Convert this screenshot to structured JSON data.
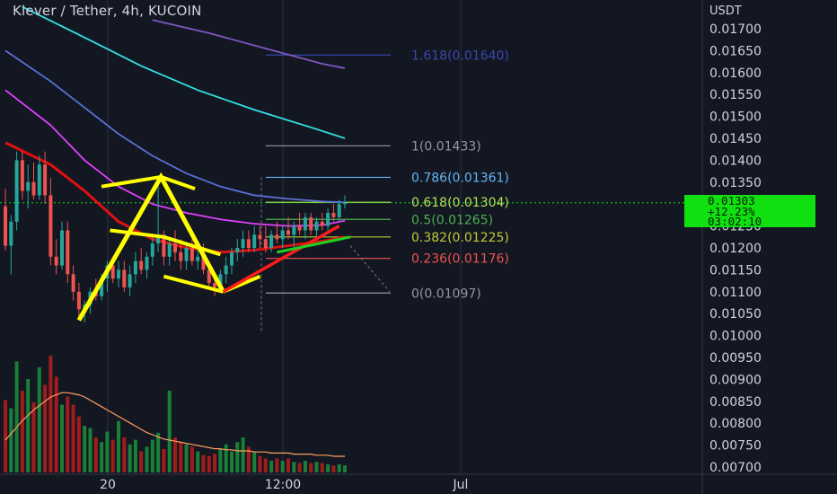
{
  "header": {
    "title": "Klever / Tether, 4h, KUCOIN"
  },
  "colors": {
    "background": "#131722",
    "axis_text": "#d1d4dc",
    "grid": "#2a2e39",
    "up": "#26a69a",
    "down": "#ef5350",
    "drawing": "#ffff00",
    "ma_red": "#e01010",
    "ma_magenta": "#e040fb",
    "ma_blue": "#5b6fd6",
    "ma_cyan": "#33e0e6",
    "ma_purple": "#7e57c2",
    "volume_ma": "#ff9e60",
    "price_tag": "#10e010"
  },
  "chart_data": {
    "type": "candlestick",
    "symbol": "Klever / Tether",
    "timeframe": "4h",
    "exchange": "KUCOIN",
    "y_axis_label": "USDT",
    "ylim": [
      0.0069,
      0.0175
    ],
    "y_ticks": [
      "0.01700",
      "0.01650",
      "0.01600",
      "0.01550",
      "0.01500",
      "0.01450",
      "0.01400",
      "0.01350",
      "0.01300",
      "0.01250",
      "0.01200",
      "0.01150",
      "0.01100",
      "0.01050",
      "0.01000",
      "0.00950",
      "0.00900",
      "0.00850",
      "0.00800",
      "0.00750",
      "0.00700"
    ],
    "x_ticks": [
      "20",
      "12:00",
      "Jul"
    ],
    "current_price": {
      "value": "0.01303",
      "change": "+12.23%",
      "countdown": "03:02:10"
    },
    "fib_levels": [
      {
        "level": "1.618",
        "value": 0.0164,
        "label": "1.618(0.01640)",
        "color": "#3949ab"
      },
      {
        "level": "1",
        "value": 0.01433,
        "label": "1(0.01433)",
        "color": "#9598a1"
      },
      {
        "level": "0.786",
        "value": 0.01361,
        "label": "0.786(0.01361)",
        "color": "#64b5f6"
      },
      {
        "level": "0.618",
        "value": 0.01304,
        "label": "0.618(0.01304)",
        "color": "#b6e35a"
      },
      {
        "level": "0.5",
        "value": 0.01265,
        "label": "0.5(0.01265)",
        "color": "#4caf50"
      },
      {
        "level": "0.382",
        "value": 0.01225,
        "label": "0.382(0.01225)",
        "color": "#c0ca33"
      },
      {
        "level": "0.236",
        "value": 0.01176,
        "label": "0.236(0.01176)",
        "color": "#ef5350"
      },
      {
        "level": "0",
        "value": 0.01097,
        "label": "0(0.01097)",
        "color": "#9598a1"
      }
    ],
    "candles": [
      {
        "o": 0.01295,
        "h": 0.01335,
        "l": 0.01195,
        "c": 0.01205
      },
      {
        "o": 0.01205,
        "h": 0.01275,
        "l": 0.0114,
        "c": 0.0126
      },
      {
        "o": 0.0126,
        "h": 0.0142,
        "l": 0.0124,
        "c": 0.014
      },
      {
        "o": 0.014,
        "h": 0.0142,
        "l": 0.0131,
        "c": 0.0133
      },
      {
        "o": 0.0133,
        "h": 0.0139,
        "l": 0.0129,
        "c": 0.0135
      },
      {
        "o": 0.0135,
        "h": 0.01395,
        "l": 0.0131,
        "c": 0.0132
      },
      {
        "o": 0.0132,
        "h": 0.0141,
        "l": 0.0131,
        "c": 0.0139
      },
      {
        "o": 0.0139,
        "h": 0.0142,
        "l": 0.013,
        "c": 0.0132
      },
      {
        "o": 0.0132,
        "h": 0.0136,
        "l": 0.0116,
        "c": 0.0118
      },
      {
        "o": 0.0118,
        "h": 0.0122,
        "l": 0.0114,
        "c": 0.0116
      },
      {
        "o": 0.0116,
        "h": 0.0126,
        "l": 0.0115,
        "c": 0.0124
      },
      {
        "o": 0.0124,
        "h": 0.0126,
        "l": 0.0112,
        "c": 0.0114
      },
      {
        "o": 0.0114,
        "h": 0.0116,
        "l": 0.0108,
        "c": 0.011
      },
      {
        "o": 0.011,
        "h": 0.0112,
        "l": 0.0104,
        "c": 0.0106
      },
      {
        "o": 0.0106,
        "h": 0.0108,
        "l": 0.0103,
        "c": 0.0107
      },
      {
        "o": 0.0107,
        "h": 0.0111,
        "l": 0.0105,
        "c": 0.011
      },
      {
        "o": 0.011,
        "h": 0.0113,
        "l": 0.0108,
        "c": 0.0109
      },
      {
        "o": 0.0109,
        "h": 0.0114,
        "l": 0.0108,
        "c": 0.0113
      },
      {
        "o": 0.0113,
        "h": 0.0117,
        "l": 0.011,
        "c": 0.0116
      },
      {
        "o": 0.0116,
        "h": 0.0118,
        "l": 0.0112,
        "c": 0.0113
      },
      {
        "o": 0.0113,
        "h": 0.0117,
        "l": 0.0111,
        "c": 0.0115
      },
      {
        "o": 0.0115,
        "h": 0.0117,
        "l": 0.011,
        "c": 0.0111
      },
      {
        "o": 0.0111,
        "h": 0.0116,
        "l": 0.0109,
        "c": 0.0114
      },
      {
        "o": 0.0114,
        "h": 0.0119,
        "l": 0.0112,
        "c": 0.0117
      },
      {
        "o": 0.0117,
        "h": 0.012,
        "l": 0.0114,
        "c": 0.0115
      },
      {
        "o": 0.0115,
        "h": 0.0119,
        "l": 0.0113,
        "c": 0.0118
      },
      {
        "o": 0.0118,
        "h": 0.0123,
        "l": 0.0116,
        "c": 0.0121
      },
      {
        "o": 0.0121,
        "h": 0.0136,
        "l": 0.0119,
        "c": 0.0123
      },
      {
        "o": 0.0123,
        "h": 0.0124,
        "l": 0.0116,
        "c": 0.0118
      },
      {
        "o": 0.0118,
        "h": 0.0122,
        "l": 0.0116,
        "c": 0.0121
      },
      {
        "o": 0.0121,
        "h": 0.0124,
        "l": 0.0117,
        "c": 0.0119
      },
      {
        "o": 0.0119,
        "h": 0.0122,
        "l": 0.0115,
        "c": 0.0117
      },
      {
        "o": 0.0117,
        "h": 0.0121,
        "l": 0.0115,
        "c": 0.012
      },
      {
        "o": 0.012,
        "h": 0.0122,
        "l": 0.0116,
        "c": 0.0117
      },
      {
        "o": 0.0117,
        "h": 0.012,
        "l": 0.0115,
        "c": 0.0118
      },
      {
        "o": 0.0118,
        "h": 0.0121,
        "l": 0.0114,
        "c": 0.0115
      },
      {
        "o": 0.0115,
        "h": 0.0116,
        "l": 0.0111,
        "c": 0.0112
      },
      {
        "o": 0.0112,
        "h": 0.0114,
        "l": 0.0109,
        "c": 0.0111
      },
      {
        "o": 0.0111,
        "h": 0.0115,
        "l": 0.011,
        "c": 0.0114
      },
      {
        "o": 0.0114,
        "h": 0.0118,
        "l": 0.0112,
        "c": 0.0116
      },
      {
        "o": 0.0116,
        "h": 0.012,
        "l": 0.0114,
        "c": 0.0119
      },
      {
        "o": 0.0119,
        "h": 0.0122,
        "l": 0.0117,
        "c": 0.012
      },
      {
        "o": 0.012,
        "h": 0.0124,
        "l": 0.0118,
        "c": 0.0122
      },
      {
        "o": 0.0122,
        "h": 0.0124,
        "l": 0.0119,
        "c": 0.012
      },
      {
        "o": 0.012,
        "h": 0.0125,
        "l": 0.0119,
        "c": 0.0123
      },
      {
        "o": 0.0123,
        "h": 0.0125,
        "l": 0.012,
        "c": 0.0122
      },
      {
        "o": 0.0122,
        "h": 0.0125,
        "l": 0.0119,
        "c": 0.012
      },
      {
        "o": 0.012,
        "h": 0.0124,
        "l": 0.0119,
        "c": 0.0123
      },
      {
        "o": 0.0123,
        "h": 0.0126,
        "l": 0.0121,
        "c": 0.0122
      },
      {
        "o": 0.0122,
        "h": 0.0125,
        "l": 0.012,
        "c": 0.0124
      },
      {
        "o": 0.0124,
        "h": 0.0127,
        "l": 0.0122,
        "c": 0.0123
      },
      {
        "o": 0.0123,
        "h": 0.0126,
        "l": 0.012,
        "c": 0.0125
      },
      {
        "o": 0.0125,
        "h": 0.0128,
        "l": 0.0123,
        "c": 0.0124
      },
      {
        "o": 0.0124,
        "h": 0.0128,
        "l": 0.0122,
        "c": 0.0127
      },
      {
        "o": 0.0127,
        "h": 0.0128,
        "l": 0.0123,
        "c": 0.0124
      },
      {
        "o": 0.0124,
        "h": 0.0127,
        "l": 0.0122,
        "c": 0.0126
      },
      {
        "o": 0.0126,
        "h": 0.0128,
        "l": 0.0124,
        "c": 0.0125
      },
      {
        "o": 0.0125,
        "h": 0.0129,
        "l": 0.0124,
        "c": 0.0128
      },
      {
        "o": 0.0128,
        "h": 0.013,
        "l": 0.0126,
        "c": 0.0127
      },
      {
        "o": 0.0127,
        "h": 0.0131,
        "l": 0.0126,
        "c": 0.013
      },
      {
        "o": 0.013,
        "h": 0.0132,
        "l": 0.0129,
        "c": 0.01303
      }
    ],
    "volume": [
      62,
      55,
      95,
      70,
      80,
      60,
      90,
      75,
      100,
      82,
      58,
      65,
      58,
      48,
      40,
      38,
      30,
      26,
      35,
      28,
      44,
      30,
      24,
      28,
      18,
      22,
      28,
      34,
      20,
      70,
      30,
      26,
      24,
      22,
      18,
      15,
      14,
      16,
      20,
      24,
      18,
      26,
      30,
      22,
      18,
      14,
      12,
      10,
      12,
      10,
      12,
      9,
      8,
      10,
      8,
      9,
      8,
      7,
      6,
      7,
      6
    ],
    "volume_ma": [
      0.3,
      0.36,
      0.42,
      0.48,
      0.53,
      0.58,
      0.62,
      0.66,
      0.7,
      0.72,
      0.74,
      0.74,
      0.73,
      0.72,
      0.7,
      0.67,
      0.64,
      0.61,
      0.58,
      0.55,
      0.52,
      0.49,
      0.46,
      0.43,
      0.4,
      0.37,
      0.35,
      0.33,
      0.31,
      0.3,
      0.29,
      0.28,
      0.27,
      0.26,
      0.25,
      0.24,
      0.23,
      0.22,
      0.22,
      0.21,
      0.21,
      0.2,
      0.2,
      0.2,
      0.19,
      0.19,
      0.19,
      0.18,
      0.18,
      0.18,
      0.18,
      0.17,
      0.17,
      0.17,
      0.17,
      0.16,
      0.16,
      0.16,
      0.15,
      0.15,
      0.15
    ],
    "moving_averages": [
      {
        "color": "#e01010",
        "points": [
          [
            0,
            0.0144
          ],
          [
            8,
            0.0139
          ],
          [
            14,
            0.0133
          ],
          [
            20,
            0.0126
          ],
          [
            26,
            0.0122
          ],
          [
            32,
            0.012
          ],
          [
            38,
            0.0119
          ],
          [
            44,
            0.01195
          ],
          [
            50,
            0.01205
          ],
          [
            56,
            0.01215
          ],
          [
            60,
            0.01225
          ]
        ]
      },
      {
        "color": "#e040fb",
        "points": [
          [
            0,
            0.0156
          ],
          [
            8,
            0.0148
          ],
          [
            14,
            0.014
          ],
          [
            20,
            0.0134
          ],
          [
            26,
            0.013
          ],
          [
            32,
            0.0128
          ],
          [
            38,
            0.01265
          ],
          [
            44,
            0.01255
          ],
          [
            50,
            0.0125
          ],
          [
            56,
            0.01252
          ],
          [
            60,
            0.01262
          ]
        ]
      },
      {
        "color": "#5b6fd6",
        "points": [
          [
            0,
            0.0165
          ],
          [
            8,
            0.0158
          ],
          [
            14,
            0.0152
          ],
          [
            20,
            0.0146
          ],
          [
            26,
            0.0141
          ],
          [
            32,
            0.0137
          ],
          [
            38,
            0.0134
          ],
          [
            44,
            0.0132
          ],
          [
            50,
            0.01312
          ],
          [
            56,
            0.01306
          ],
          [
            60,
            0.01304
          ]
        ]
      },
      {
        "color": "#33e0e6",
        "points": [
          [
            3,
            0.0175
          ],
          [
            14,
            0.0168
          ],
          [
            24,
            0.01615
          ],
          [
            34,
            0.0156
          ],
          [
            44,
            0.01515
          ],
          [
            54,
            0.01475
          ],
          [
            60,
            0.0145
          ]
        ]
      },
      {
        "color": "#7e57c2",
        "points": [
          [
            26,
            0.0172
          ],
          [
            36,
            0.0169
          ],
          [
            46,
            0.01655
          ],
          [
            56,
            0.0162
          ],
          [
            60,
            0.0161
          ]
        ]
      }
    ]
  }
}
